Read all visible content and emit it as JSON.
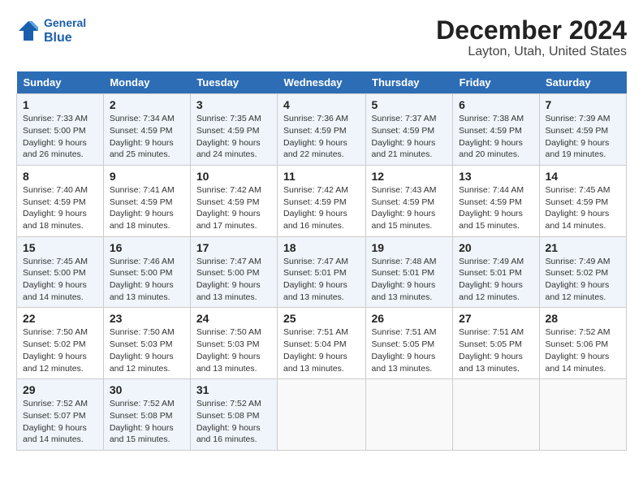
{
  "header": {
    "logo_line1": "General",
    "logo_line2": "Blue",
    "title": "December 2024",
    "subtitle": "Layton, Utah, United States"
  },
  "calendar": {
    "headers": [
      "Sunday",
      "Monday",
      "Tuesday",
      "Wednesday",
      "Thursday",
      "Friday",
      "Saturday"
    ],
    "weeks": [
      [
        {
          "day": "",
          "empty": true
        },
        {
          "day": "",
          "empty": true
        },
        {
          "day": "",
          "empty": true
        },
        {
          "day": "",
          "empty": true
        },
        {
          "day": "",
          "empty": true
        },
        {
          "day": "",
          "empty": true
        },
        {
          "day": "",
          "empty": true
        }
      ],
      [
        {
          "num": "1",
          "sunrise": "Sunrise: 7:33 AM",
          "sunset": "Sunset: 5:00 PM",
          "daylight": "Daylight: 9 hours and 26 minutes."
        },
        {
          "num": "2",
          "sunrise": "Sunrise: 7:34 AM",
          "sunset": "Sunset: 4:59 PM",
          "daylight": "Daylight: 9 hours and 25 minutes."
        },
        {
          "num": "3",
          "sunrise": "Sunrise: 7:35 AM",
          "sunset": "Sunset: 4:59 PM",
          "daylight": "Daylight: 9 hours and 24 minutes."
        },
        {
          "num": "4",
          "sunrise": "Sunrise: 7:36 AM",
          "sunset": "Sunset: 4:59 PM",
          "daylight": "Daylight: 9 hours and 22 minutes."
        },
        {
          "num": "5",
          "sunrise": "Sunrise: 7:37 AM",
          "sunset": "Sunset: 4:59 PM",
          "daylight": "Daylight: 9 hours and 21 minutes."
        },
        {
          "num": "6",
          "sunrise": "Sunrise: 7:38 AM",
          "sunset": "Sunset: 4:59 PM",
          "daylight": "Daylight: 9 hours and 20 minutes."
        },
        {
          "num": "7",
          "sunrise": "Sunrise: 7:39 AM",
          "sunset": "Sunset: 4:59 PM",
          "daylight": "Daylight: 9 hours and 19 minutes."
        }
      ],
      [
        {
          "num": "8",
          "sunrise": "Sunrise: 7:40 AM",
          "sunset": "Sunset: 4:59 PM",
          "daylight": "Daylight: 9 hours and 18 minutes."
        },
        {
          "num": "9",
          "sunrise": "Sunrise: 7:41 AM",
          "sunset": "Sunset: 4:59 PM",
          "daylight": "Daylight: 9 hours and 18 minutes."
        },
        {
          "num": "10",
          "sunrise": "Sunrise: 7:42 AM",
          "sunset": "Sunset: 4:59 PM",
          "daylight": "Daylight: 9 hours and 17 minutes."
        },
        {
          "num": "11",
          "sunrise": "Sunrise: 7:42 AM",
          "sunset": "Sunset: 4:59 PM",
          "daylight": "Daylight: 9 hours and 16 minutes."
        },
        {
          "num": "12",
          "sunrise": "Sunrise: 7:43 AM",
          "sunset": "Sunset: 4:59 PM",
          "daylight": "Daylight: 9 hours and 15 minutes."
        },
        {
          "num": "13",
          "sunrise": "Sunrise: 7:44 AM",
          "sunset": "Sunset: 4:59 PM",
          "daylight": "Daylight: 9 hours and 15 minutes."
        },
        {
          "num": "14",
          "sunrise": "Sunrise: 7:45 AM",
          "sunset": "Sunset: 4:59 PM",
          "daylight": "Daylight: 9 hours and 14 minutes."
        }
      ],
      [
        {
          "num": "15",
          "sunrise": "Sunrise: 7:45 AM",
          "sunset": "Sunset: 5:00 PM",
          "daylight": "Daylight: 9 hours and 14 minutes."
        },
        {
          "num": "16",
          "sunrise": "Sunrise: 7:46 AM",
          "sunset": "Sunset: 5:00 PM",
          "daylight": "Daylight: 9 hours and 13 minutes."
        },
        {
          "num": "17",
          "sunrise": "Sunrise: 7:47 AM",
          "sunset": "Sunset: 5:00 PM",
          "daylight": "Daylight: 9 hours and 13 minutes."
        },
        {
          "num": "18",
          "sunrise": "Sunrise: 7:47 AM",
          "sunset": "Sunset: 5:01 PM",
          "daylight": "Daylight: 9 hours and 13 minutes."
        },
        {
          "num": "19",
          "sunrise": "Sunrise: 7:48 AM",
          "sunset": "Sunset: 5:01 PM",
          "daylight": "Daylight: 9 hours and 13 minutes."
        },
        {
          "num": "20",
          "sunrise": "Sunrise: 7:49 AM",
          "sunset": "Sunset: 5:01 PM",
          "daylight": "Daylight: 9 hours and 12 minutes."
        },
        {
          "num": "21",
          "sunrise": "Sunrise: 7:49 AM",
          "sunset": "Sunset: 5:02 PM",
          "daylight": "Daylight: 9 hours and 12 minutes."
        }
      ],
      [
        {
          "num": "22",
          "sunrise": "Sunrise: 7:50 AM",
          "sunset": "Sunset: 5:02 PM",
          "daylight": "Daylight: 9 hours and 12 minutes."
        },
        {
          "num": "23",
          "sunrise": "Sunrise: 7:50 AM",
          "sunset": "Sunset: 5:03 PM",
          "daylight": "Daylight: 9 hours and 12 minutes."
        },
        {
          "num": "24",
          "sunrise": "Sunrise: 7:50 AM",
          "sunset": "Sunset: 5:03 PM",
          "daylight": "Daylight: 9 hours and 13 minutes."
        },
        {
          "num": "25",
          "sunrise": "Sunrise: 7:51 AM",
          "sunset": "Sunset: 5:04 PM",
          "daylight": "Daylight: 9 hours and 13 minutes."
        },
        {
          "num": "26",
          "sunrise": "Sunrise: 7:51 AM",
          "sunset": "Sunset: 5:05 PM",
          "daylight": "Daylight: 9 hours and 13 minutes."
        },
        {
          "num": "27",
          "sunrise": "Sunrise: 7:51 AM",
          "sunset": "Sunset: 5:05 PM",
          "daylight": "Daylight: 9 hours and 13 minutes."
        },
        {
          "num": "28",
          "sunrise": "Sunrise: 7:52 AM",
          "sunset": "Sunset: 5:06 PM",
          "daylight": "Daylight: 9 hours and 14 minutes."
        }
      ],
      [
        {
          "num": "29",
          "sunrise": "Sunrise: 7:52 AM",
          "sunset": "Sunset: 5:07 PM",
          "daylight": "Daylight: 9 hours and 14 minutes."
        },
        {
          "num": "30",
          "sunrise": "Sunrise: 7:52 AM",
          "sunset": "Sunset: 5:08 PM",
          "daylight": "Daylight: 9 hours and 15 minutes."
        },
        {
          "num": "31",
          "sunrise": "Sunrise: 7:52 AM",
          "sunset": "Sunset: 5:08 PM",
          "daylight": "Daylight: 9 hours and 16 minutes."
        },
        {
          "empty": true
        },
        {
          "empty": true
        },
        {
          "empty": true
        },
        {
          "empty": true
        }
      ]
    ]
  }
}
